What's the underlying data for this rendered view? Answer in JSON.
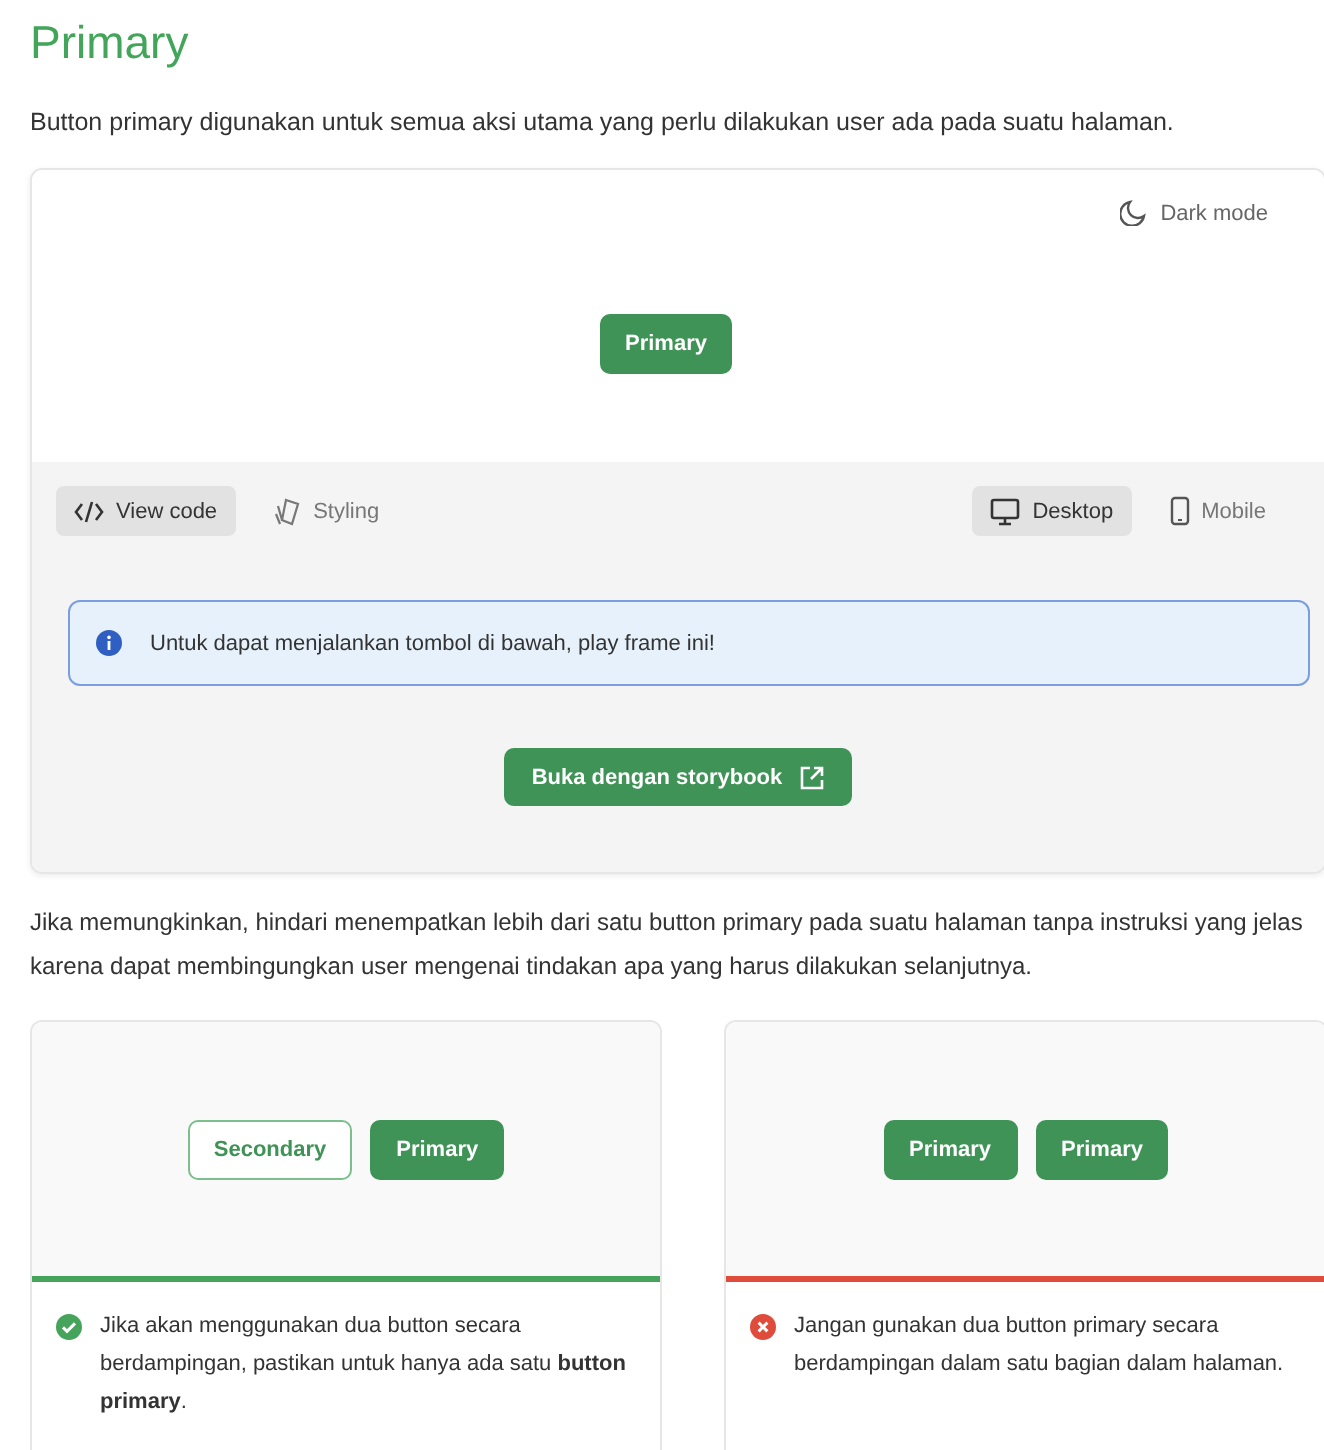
{
  "title": "Primary",
  "description": "Button primary digunakan untuk semua aksi utama yang perlu dilakukan user ada pada suatu halaman.",
  "preview": {
    "dark_mode_label": "Dark mode",
    "button_label": "Primary",
    "tools": [
      {
        "label": "View code",
        "kind": "code",
        "selected": true
      },
      {
        "label": "Styling",
        "kind": "styling",
        "selected": false
      }
    ],
    "viewports": [
      {
        "label": "Desktop",
        "kind": "desktop",
        "selected": true
      },
      {
        "label": "Mobile",
        "kind": "mobile",
        "selected": false
      }
    ],
    "alert": "Untuk dapat menjalankan tombol di bawah, play frame ini!",
    "storybook_button": "Buka dengan storybook"
  },
  "guidance": "Jika memungkinkan, hindari menempatkan lebih dari satu button primary pada suatu halaman tanpa instruksi yang jelas karena dapat membingungkan user mengenai tindakan apa yang harus dilakukan selanjutnya.",
  "examples": [
    {
      "kind": "do",
      "buttons": [
        {
          "label": "Secondary",
          "kind": "secondary"
        },
        {
          "label": "Primary",
          "kind": "primary"
        }
      ],
      "text": "Jika akan menggunakan dua button secara berdampingan, pastikan untuk hanya ada satu **button primary**."
    },
    {
      "kind": "dont",
      "buttons": [
        {
          "label": "Primary",
          "kind": "primary"
        },
        {
          "label": "Primary",
          "kind": "primary"
        }
      ],
      "text": "Jangan gunakan dua button primary secara berdampingan dalam satu bagian dalam halaman."
    }
  ]
}
